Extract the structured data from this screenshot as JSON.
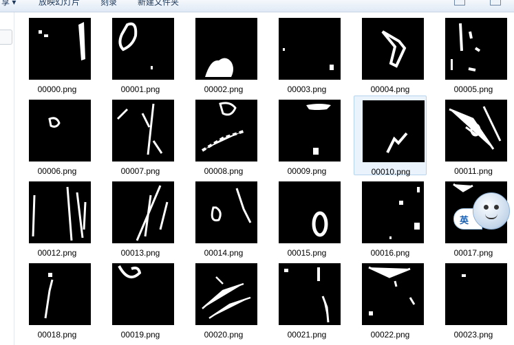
{
  "toolbar": {
    "items": [
      {
        "label": "享 ▾"
      },
      {
        "label": "放映幻灯片"
      },
      {
        "label": "刻录"
      },
      {
        "label": "新建文件夹"
      }
    ],
    "right_icons": [
      "view-options-icon",
      "help-icon"
    ]
  },
  "files": [
    {
      "name": "00000.png"
    },
    {
      "name": "00001.png"
    },
    {
      "name": "00002.png"
    },
    {
      "name": "00003.png"
    },
    {
      "name": "00004.png"
    },
    {
      "name": "00005.png"
    },
    {
      "name": "00006.png"
    },
    {
      "name": "00007.png"
    },
    {
      "name": "00008.png"
    },
    {
      "name": "00009.png"
    },
    {
      "name": "00010.png",
      "selected": true
    },
    {
      "name": "00011.png"
    },
    {
      "name": "00012.png"
    },
    {
      "name": "00013.png"
    },
    {
      "name": "00014.png"
    },
    {
      "name": "00015.png"
    },
    {
      "name": "00016.png"
    },
    {
      "name": "00017.png"
    },
    {
      "name": "00018.png"
    },
    {
      "name": "00019.png"
    },
    {
      "name": "00020.png"
    },
    {
      "name": "00021.png"
    },
    {
      "name": "00022.png"
    },
    {
      "name": "00023.png"
    }
  ],
  "ime": {
    "label": "英"
  },
  "colors": {
    "selection": "#eaf3fc",
    "selection_border": "#b6d3ee",
    "thumbnail_bg": "#000000",
    "mask_fg": "#ffffff"
  }
}
